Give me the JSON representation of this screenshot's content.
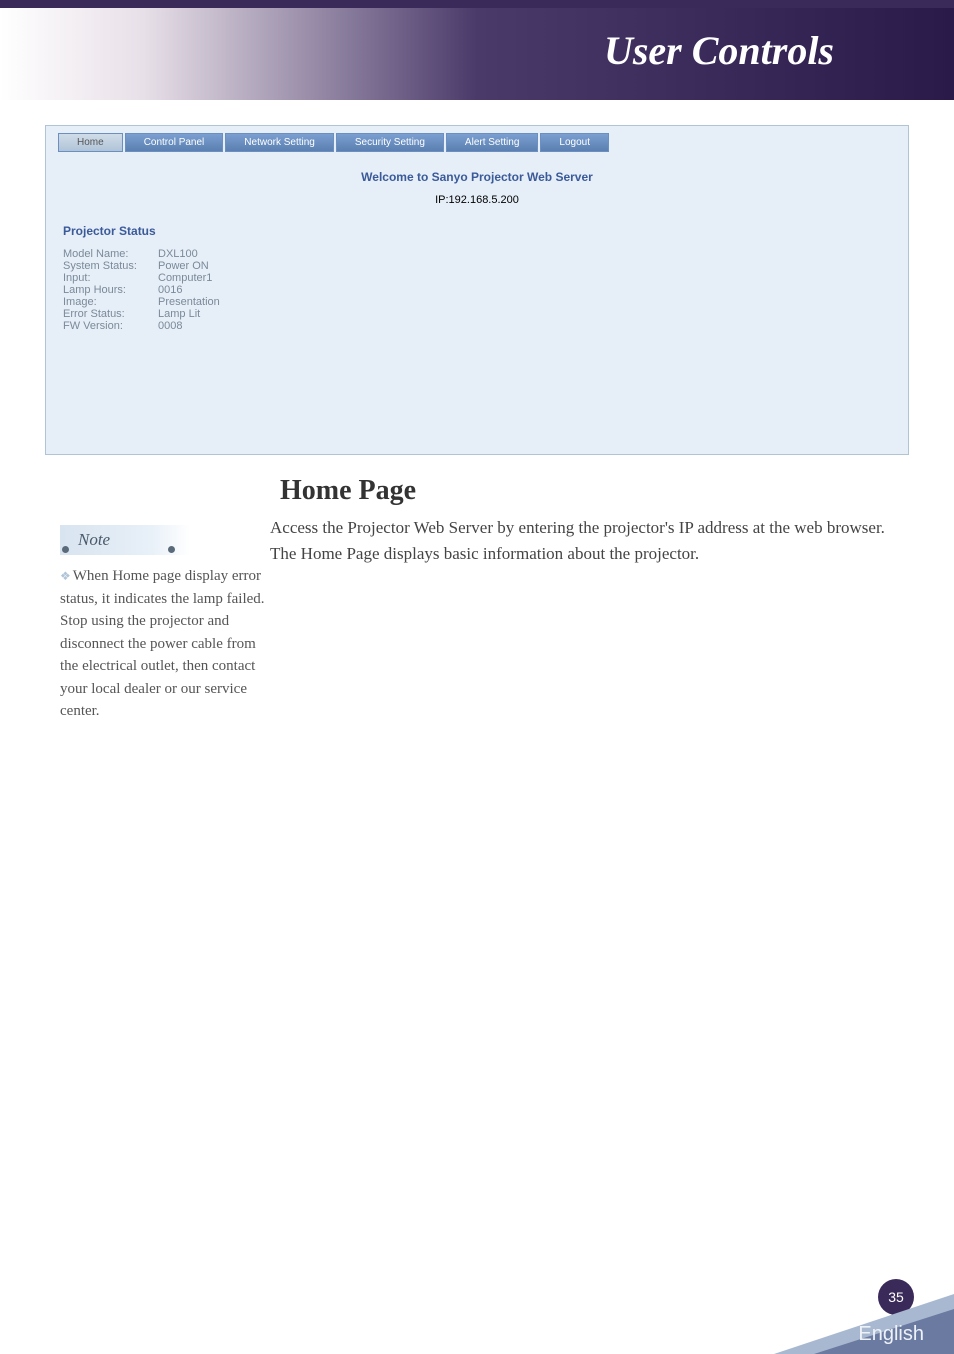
{
  "header": {
    "title": "User Controls"
  },
  "screenshot": {
    "tabs": [
      {
        "label": "Home",
        "active": true
      },
      {
        "label": "Control Panel",
        "active": false
      },
      {
        "label": "Network Setting",
        "active": false
      },
      {
        "label": "Security Setting",
        "active": false
      },
      {
        "label": "Alert Setting",
        "active": false
      },
      {
        "label": "Logout",
        "active": false
      }
    ],
    "welcome": "Welcome to Sanyo Projector Web Server",
    "ip": "IP:192.168.5.200",
    "status_title": "Projector Status",
    "status": [
      {
        "label": "Model Name:",
        "value": "DXL100"
      },
      {
        "label": "System Status:",
        "value": "Power ON"
      },
      {
        "label": "Input:",
        "value": "Computer1"
      },
      {
        "label": "Lamp Hours:",
        "value": "0016"
      },
      {
        "label": "Image:",
        "value": "Presentation"
      },
      {
        "label": "Error Status:",
        "value": "Lamp Lit"
      },
      {
        "label": "FW Version:",
        "value": "0008"
      }
    ]
  },
  "section": {
    "title": "Home Page",
    "body": "Access the Projector Web Server by entering the projector's IP address at the web browser. The Home Page displays basic information about the projector."
  },
  "note": {
    "label": "Note",
    "text": "When Home page display error status, it indicates the lamp failed. Stop using the projector and disconnect the power cable from the electrical outlet, then contact your local dealer or our service center."
  },
  "footer": {
    "page": "35",
    "language": "English"
  }
}
